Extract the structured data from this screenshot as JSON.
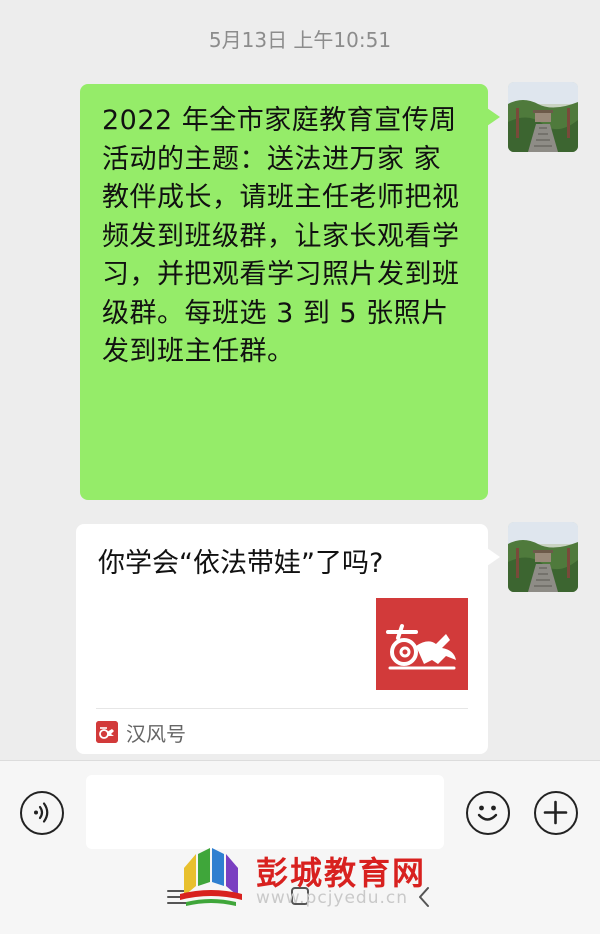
{
  "timestamp": "5月13日 上午10:51",
  "messages": [
    {
      "type": "text",
      "text": "2022 年全市家庭教育宣传周活动的主题：送法进万家 家教伴成长，请班主任老师把视频发到班级群，让家长观看学习，并把观看学习照片发到班级群。每班选 3 到 5 张照片发到班主任群。"
    },
    {
      "type": "card",
      "title": "你学会“依法带娃”了吗?",
      "source": "汉风号"
    }
  ],
  "input_bar": {
    "voice_icon": "voice-icon",
    "emoji_icon": "emoji-icon",
    "plus_icon": "plus-icon",
    "input_value": ""
  },
  "watermark": {
    "title": "彭城教育网",
    "url": "www.pcjyedu.cn"
  },
  "colors": {
    "bubble_green": "#95ec69",
    "background": "#ededed",
    "card_thumb": "#d23a3a",
    "watermark_red": "#d8211f"
  }
}
